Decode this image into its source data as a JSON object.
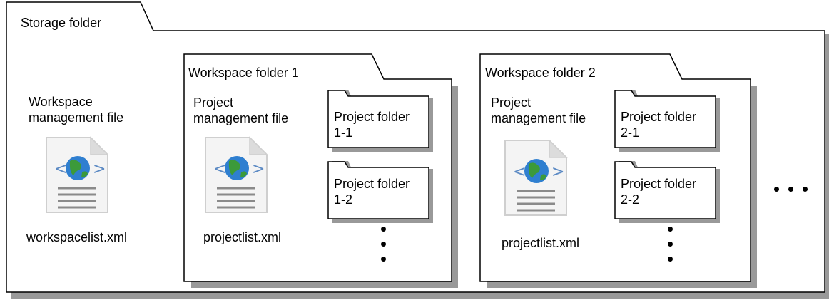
{
  "storage": {
    "title": "Storage folder",
    "workspace_file": {
      "label_line1": "Workspace",
      "label_line2": "management file",
      "icon": "xml-file-icon",
      "filename": "workspacelist.xml"
    }
  },
  "workspaces": [
    {
      "title": "Workspace folder 1",
      "project_file": {
        "label_line1": "Project",
        "label_line2": "management file",
        "icon": "xml-file-icon",
        "filename": "projectlist.xml"
      },
      "project_folders": [
        {
          "line1": "Project folder",
          "line2": "1-1"
        },
        {
          "line1": "Project folder",
          "line2": "1-2"
        }
      ]
    },
    {
      "title": "Workspace folder 2",
      "project_file": {
        "label_line1": "Project",
        "label_line2": "management file",
        "icon": "xml-file-icon",
        "filename": "projectlist.xml"
      },
      "project_folders": [
        {
          "line1": "Project folder",
          "line2": "2-1"
        },
        {
          "line1": "Project folder",
          "line2": "2-2"
        }
      ]
    }
  ],
  "colors": {
    "stroke": "#000000",
    "shadow": "#999999",
    "globe_blue": "#2f7fd0",
    "globe_green": "#3c9a3a"
  }
}
